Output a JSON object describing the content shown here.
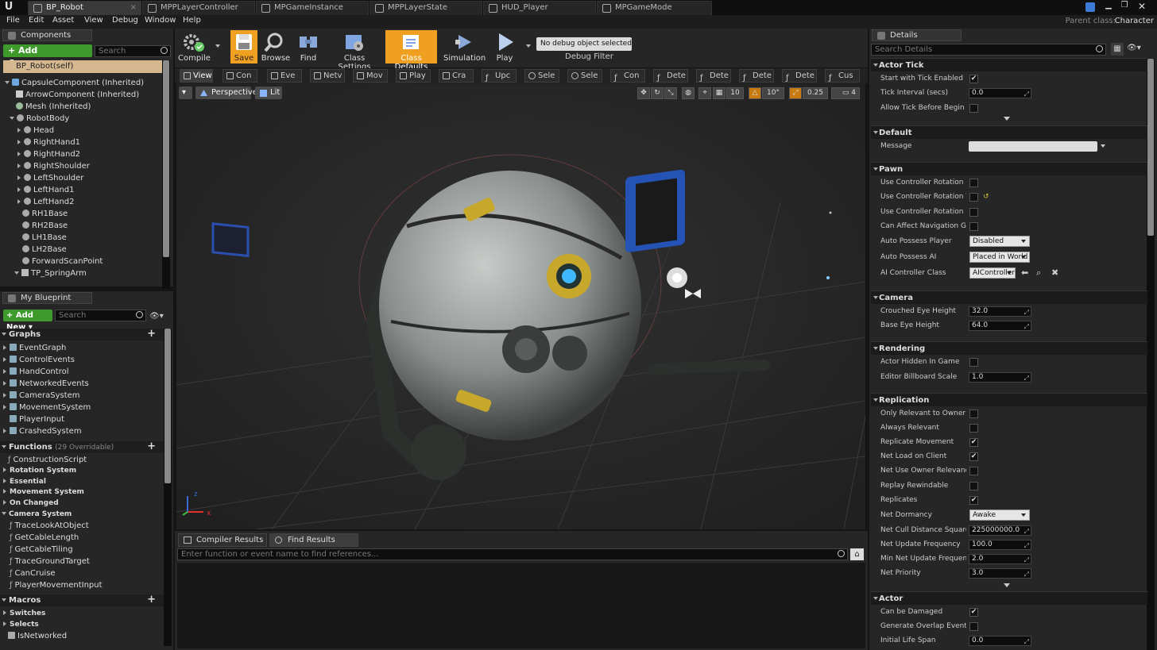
{
  "app": {
    "logo": "U"
  },
  "doc_tabs": [
    "BP_Robot",
    "MPPLayerController",
    "MPGameInstance",
    "MPPLayerState",
    "HUD_Player",
    "MPGameMode"
  ],
  "menu": [
    "File",
    "Edit",
    "Asset",
    "View",
    "Debug",
    "Window",
    "Help"
  ],
  "parent_class": {
    "label": "Parent class:",
    "value": "Character"
  },
  "components": {
    "tab": "Components",
    "add_label": "+ Add Component ▾",
    "search_placeholder": "Search",
    "self": "BP_Robot(self)",
    "items": [
      "CapsuleComponent (Inherited)",
      "ArrowComponent (Inherited)",
      "Mesh (Inherited)",
      "RobotBody",
      "Head",
      "RightHand1",
      "RightHand2",
      "RightShoulder",
      "LeftShoulder",
      "LeftHand1",
      "LeftHand2",
      "RH1Base",
      "RH2Base",
      "LH1Base",
      "LH2Base",
      "ForwardScanPoint",
      "TP_SpringArm"
    ]
  },
  "my_blueprint": {
    "tab": "My Blueprint",
    "add_label": "+ Add New ▾",
    "search_placeholder": "Search",
    "graphs_header": "Graphs",
    "graphs": [
      "EventGraph",
      "ControlEvents",
      "HandControl",
      "NetworkedEvents",
      "CameraSystem",
      "MovementSystem",
      "PlayerInput",
      "CrashedSystem"
    ],
    "functions_header": "Functions",
    "functions_count": "(29 Overridable)",
    "function_items": [
      "ConstructionScript",
      "Rotation System",
      "Essential",
      "Movement System",
      "On Changed",
      "Camera System",
      "TraceLookAtObject",
      "GetCableLength",
      "GetCableTiling",
      "TraceGroundTarget",
      "CanCruise",
      "PlayerMovementInput"
    ],
    "macros_header": "Macros",
    "macro_items": [
      "Switches",
      "Selects",
      "IsNetworked"
    ]
  },
  "toolbar": {
    "compile": "Compile",
    "save": "Save",
    "browse": "Browse",
    "find": "Find",
    "class_settings": "Class Settings",
    "class_defaults": "Class Defaults",
    "simulation": "Simulation",
    "play": "Play",
    "debug_object": "No debug object selected ▾",
    "debug_filter": "Debug Filter"
  },
  "graph_tabs": [
    "View",
    "Con",
    "Eve",
    "Netv",
    "Mov",
    "Play",
    "Cra",
    "Upc",
    "Sele",
    "Sele",
    "Con",
    "Dete",
    "Dete",
    "Dete",
    "Dete",
    "Cus"
  ],
  "viewport": {
    "perspective": "Perspective",
    "lit": "Lit",
    "grid_snap": "10",
    "rot_snap": "10°",
    "scale_snap": "0.25",
    "cam_speed": "4",
    "axis_x": "x",
    "axis_z": "z"
  },
  "bottom": {
    "tabs": [
      "Compiler Results",
      "Find Results"
    ],
    "find_placeholder": "Enter function or event name to find references..."
  },
  "details": {
    "tab": "Details",
    "search_placeholder": "Search Details",
    "sections": {
      "actor_tick": "Actor Tick",
      "default": "Default",
      "pawn": "Pawn",
      "camera": "Camera",
      "rendering": "Rendering",
      "replication": "Replication",
      "actor": "Actor"
    },
    "rows": {
      "start_tick": "Start with Tick Enabled",
      "tick_interval": "Tick Interval (secs)",
      "tick_interval_val": "0.0",
      "allow_tick": "Allow Tick Before Begin Play",
      "message": "Message",
      "use_ctrl_pitch": "Use Controller Rotation Pitch",
      "use_ctrl_yaw": "Use Controller Rotation Yaw",
      "use_ctrl_roll": "Use Controller Rotation Roll",
      "can_affect_nav": "Can Affect Navigation Generation",
      "auto_possess_player": "Auto Possess Player",
      "auto_possess_player_val": "Disabled",
      "auto_possess_ai": "Auto Possess AI",
      "auto_possess_ai_val": "Placed in World",
      "ai_controller": "AI Controller Class",
      "ai_controller_val": "AIController",
      "crouched_eye": "Crouched Eye Height",
      "crouched_eye_val": "32.0",
      "base_eye": "Base Eye Height",
      "base_eye_val": "64.0",
      "actor_hidden": "Actor Hidden In Game",
      "billboard": "Editor Billboard Scale",
      "billboard_val": "1.0",
      "only_relevant": "Only Relevant to Owner",
      "always_relevant": "Always Relevant",
      "replicate_movement": "Replicate Movement",
      "net_load": "Net Load on Client",
      "net_use_owner": "Net Use Owner Relevancy",
      "replay_rewindable": "Replay Rewindable",
      "replicates": "Replicates",
      "net_dormancy": "Net Dormancy",
      "net_dormancy_val": "Awake",
      "net_cull": "Net Cull Distance Squared",
      "net_cull_val": "225000000.0",
      "net_update": "Net Update Frequency",
      "net_update_val": "100.0",
      "min_net_update": "Min Net Update Frequency",
      "min_net_update_val": "2.0",
      "net_priority": "Net Priority",
      "net_priority_val": "3.0",
      "can_be_damaged": "Can be Damaged",
      "gen_overlap": "Generate Overlap Events During Level Streaming",
      "initial_life": "Initial Life Span",
      "initial_life_val": "0.0"
    }
  }
}
